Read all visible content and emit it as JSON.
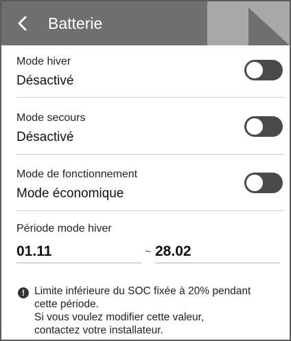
{
  "header": {
    "title": "Batterie",
    "back_icon": "chevron-left-icon",
    "background": "#6f6f6f"
  },
  "settings": [
    {
      "label": "Mode hiver",
      "value": "Désactivé",
      "toggle_on": false
    },
    {
      "label": "Mode secours",
      "value": "Désactivé",
      "toggle_on": false
    },
    {
      "label": "Mode de fonctionnement",
      "value": "Mode économique",
      "toggle_on": false
    }
  ],
  "winter_period": {
    "label": "Période mode hiver",
    "start": "01.11",
    "separator": "~",
    "end": "28.02"
  },
  "note": {
    "icon": "exclamation-info-icon",
    "lines": [
      "Limite inférieure du SOC fixée à 20% pendant",
      "cette période.",
      "Si vous voulez modifier cette valeur,",
      "contactez votre installateur."
    ]
  },
  "colors": {
    "toggle_off": "#4a4a4a",
    "separator": "#cfcfcf"
  }
}
